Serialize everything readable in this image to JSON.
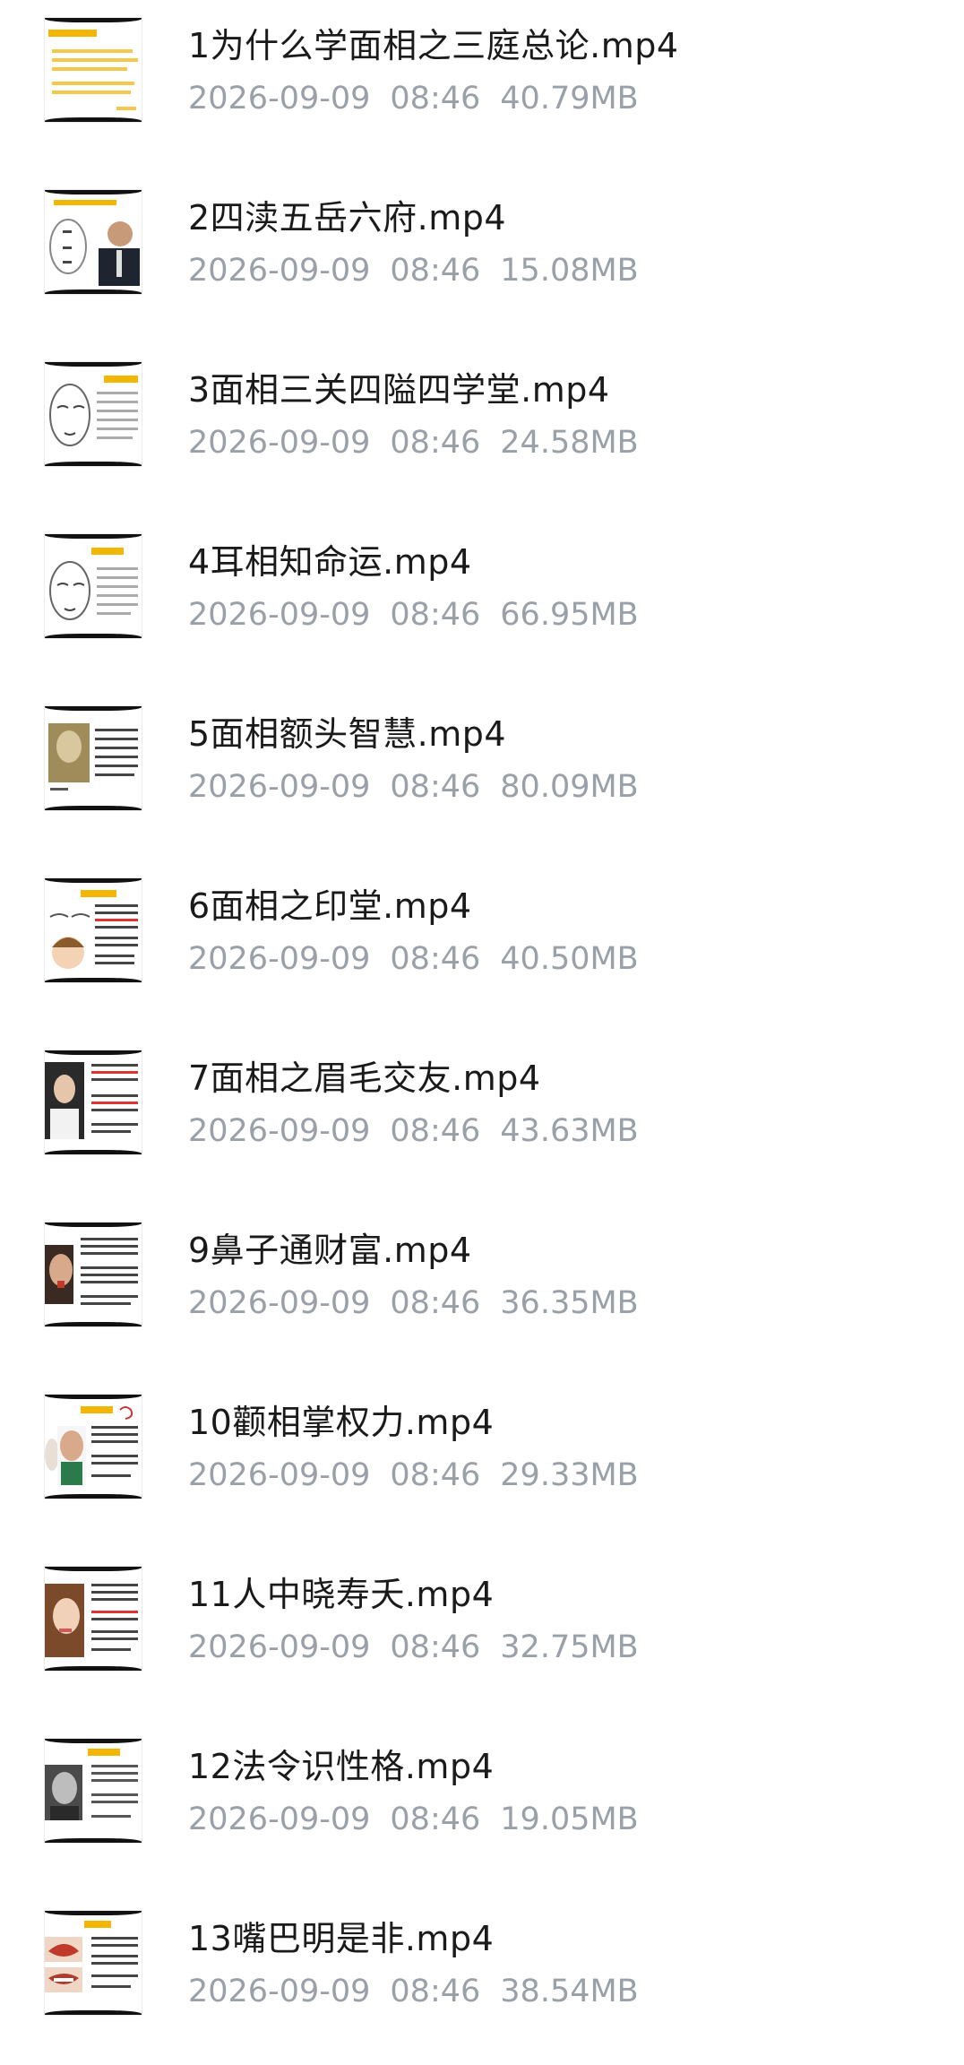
{
  "files": [
    {
      "title": "1为什么学面相之三庭总论.mp4",
      "date": "2026-09-09",
      "time": "08:46",
      "size": "40.79MB",
      "thumb": "yellow-text-slide-icon"
    },
    {
      "title": "2四渎五岳六府.mp4",
      "date": "2026-09-09",
      "time": "08:46",
      "size": "15.08MB",
      "thumb": "face-diagram-man-photo-icon"
    },
    {
      "title": "3面相三关四隘四学堂.mp4",
      "date": "2026-09-09",
      "time": "08:46",
      "size": "24.58MB",
      "thumb": "face-sketch-text-icon"
    },
    {
      "title": "4耳相知命运.mp4",
      "date": "2026-09-09",
      "time": "08:46",
      "size": "66.95MB",
      "thumb": "face-sketch-text-icon"
    },
    {
      "title": "5面相额头智慧.mp4",
      "date": "2026-09-09",
      "time": "08:46",
      "size": "80.09MB",
      "thumb": "portrait-text-icon"
    },
    {
      "title": "6面相之印堂.mp4",
      "date": "2026-09-09",
      "time": "08:46",
      "size": "40.50MB",
      "thumb": "cartoon-face-text-icon"
    },
    {
      "title": "7面相之眉毛交友.mp4",
      "date": "2026-09-09",
      "time": "08:46",
      "size": "43.63MB",
      "thumb": "woman-photo-text-icon"
    },
    {
      "title": "9鼻子通财富.mp4",
      "date": "2026-09-09",
      "time": "08:46",
      "size": "36.35MB",
      "thumb": "man-photo-text-icon"
    },
    {
      "title": "10颧相掌权力.mp4",
      "date": "2026-09-09",
      "time": "08:46",
      "size": "29.33MB",
      "thumb": "man-photo-text-icon"
    },
    {
      "title": "11人中晓寿夭.mp4",
      "date": "2026-09-09",
      "time": "08:46",
      "size": "32.75MB",
      "thumb": "woman-photo-text-icon"
    },
    {
      "title": "12法令识性格.mp4",
      "date": "2026-09-09",
      "time": "08:46",
      "size": "19.05MB",
      "thumb": "bw-portrait-text-icon"
    },
    {
      "title": "13嘴巴明是非.mp4",
      "date": "2026-09-09",
      "time": "08:46",
      "size": "38.54MB",
      "thumb": "lips-photo-text-icon"
    }
  ],
  "colors": {
    "title": "#1a1a1a",
    "meta": "#9aa0a8",
    "accent_yellow": "#f2b705",
    "background": "#ffffff"
  }
}
